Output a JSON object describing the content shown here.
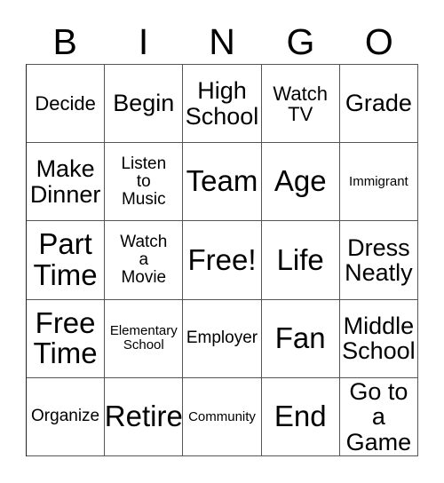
{
  "card": {
    "headers": [
      "B",
      "I",
      "N",
      "G",
      "O"
    ],
    "rows": [
      [
        {
          "label": "Decide",
          "size": "md"
        },
        {
          "label": "Begin",
          "size": "lg"
        },
        {
          "label": "High\nSchool",
          "size": "lg"
        },
        {
          "label": "Watch\nTV",
          "size": "md"
        },
        {
          "label": "Grade",
          "size": "lg"
        }
      ],
      [
        {
          "label": "Make\nDinner",
          "size": "lg"
        },
        {
          "label": "Listen\nto\nMusic",
          "size": "sm"
        },
        {
          "label": "Team",
          "size": "xl"
        },
        {
          "label": "Age",
          "size": "xl"
        },
        {
          "label": "Immigrant",
          "size": "xs"
        }
      ],
      [
        {
          "label": "Part\nTime",
          "size": "xl"
        },
        {
          "label": "Watch\na\nMovie",
          "size": "sm"
        },
        {
          "label": "Free!",
          "size": "xl"
        },
        {
          "label": "Life",
          "size": "xl"
        },
        {
          "label": "Dress\nNeatly",
          "size": "lg"
        }
      ],
      [
        {
          "label": "Free\nTime",
          "size": "xl"
        },
        {
          "label": "Elementary\nSchool",
          "size": "xs"
        },
        {
          "label": "Employer",
          "size": "sm"
        },
        {
          "label": "Fan",
          "size": "xl"
        },
        {
          "label": "Middle\nSchool",
          "size": "lg"
        }
      ],
      [
        {
          "label": "Organize",
          "size": "sm"
        },
        {
          "label": "Retire",
          "size": "xl"
        },
        {
          "label": "Community",
          "size": "xs"
        },
        {
          "label": "End",
          "size": "xl"
        },
        {
          "label": "Go to a\nGame",
          "size": "lg"
        }
      ]
    ]
  },
  "colors": {
    "cell_background": "#ffffff",
    "text": "#000000",
    "grid_line": "#555555"
  }
}
